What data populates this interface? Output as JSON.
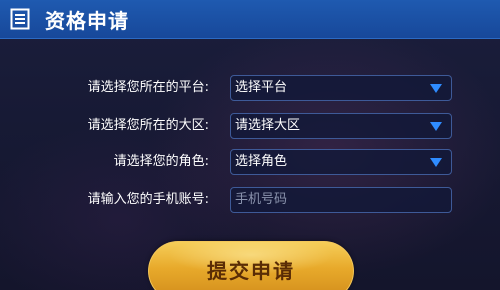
{
  "header": {
    "title": "资格申请",
    "icon": "document-list-icon"
  },
  "form": {
    "platform": {
      "label": "请选择您所在的平台:",
      "value": "选择平台"
    },
    "region": {
      "label": "请选择您所在的大区:",
      "value": "请选择大区"
    },
    "character": {
      "label": "请选择您的角色:",
      "value": "选择角色"
    },
    "phone": {
      "label": "请输入您的手机账号:",
      "placeholder": "手机号码",
      "value": ""
    }
  },
  "submit": {
    "label": "提交申请"
  },
  "colors": {
    "header_blue": "#1f5ab0",
    "dropdown_arrow": "#2f8cff",
    "button_gold": "#e8aa2b"
  }
}
